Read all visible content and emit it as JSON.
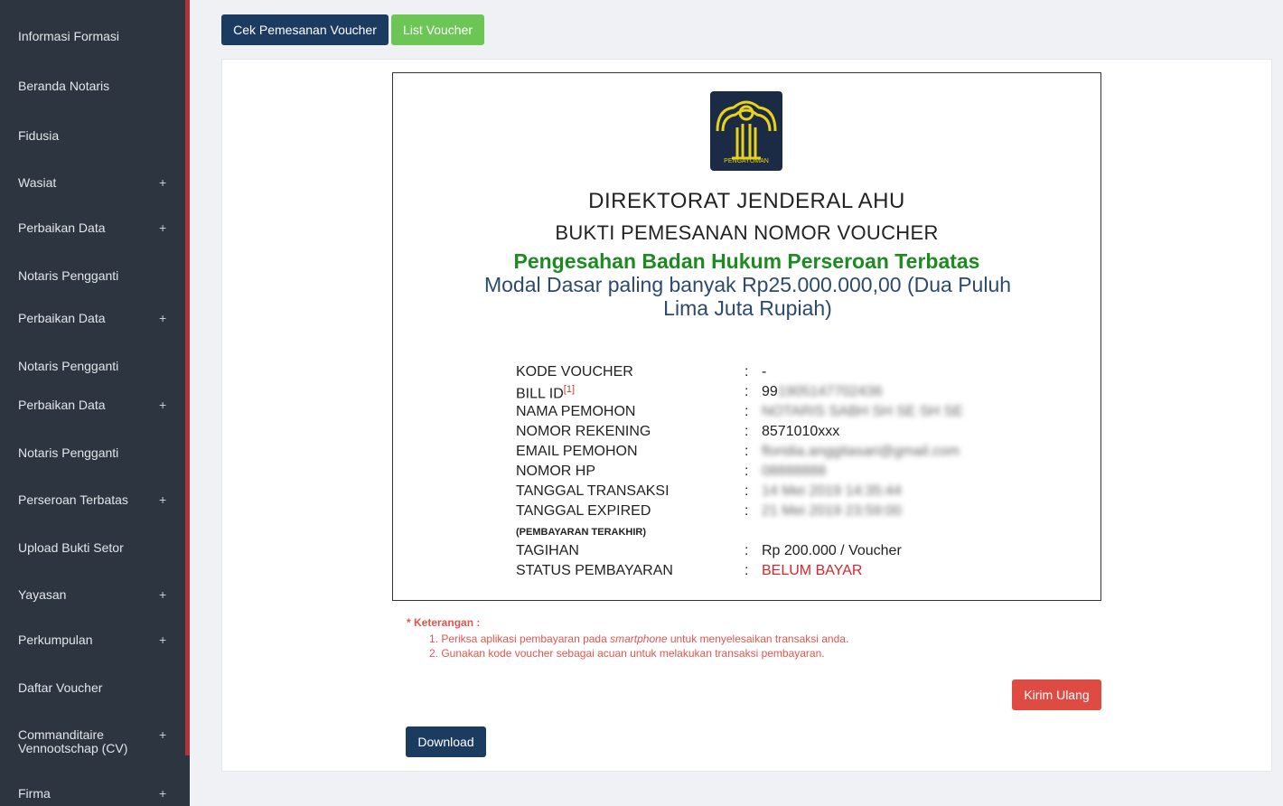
{
  "sidebar": {
    "items": [
      {
        "label": "Informasi Formasi",
        "expandable": false
      },
      {
        "label": "Beranda Notaris",
        "expandable": false
      },
      {
        "label": "Fidusia",
        "expandable": false
      },
      {
        "label": "Wasiat",
        "expandable": true
      },
      {
        "label": "Perbaikan Data",
        "expandable": true
      },
      {
        "label": "Notaris Pengganti",
        "expandable": false
      },
      {
        "label": "Perbaikan Data",
        "expandable": true
      },
      {
        "label": "Notaris Pengganti",
        "expandable": false
      },
      {
        "label": "Perbaikan Data",
        "expandable": true
      },
      {
        "label": "Notaris Pengganti",
        "expandable": false
      },
      {
        "label": "Perseroan Terbatas",
        "expandable": true
      },
      {
        "label": "Upload Bukti Setor",
        "expandable": false
      },
      {
        "label": "Yayasan",
        "expandable": true
      },
      {
        "label": "Perkumpulan",
        "expandable": true
      },
      {
        "label": "Daftar Voucher",
        "expandable": false
      },
      {
        "label": "Commanditaire Vennootschap (CV)",
        "expandable": true
      },
      {
        "label": "Firma",
        "expandable": true
      }
    ],
    "plus_symbol": "+"
  },
  "toolbar": {
    "cek_label": "Cek Pemesanan Voucher",
    "list_label": "List Voucher"
  },
  "receipt": {
    "logo_text": "PENGAYOMAN",
    "title": "DIREKTORAT JENDERAL AHU",
    "subtitle": "BUKTI PEMESANAN NOMOR VOUCHER",
    "service": "Pengesahan Badan Hukum Perseroan Terbatas",
    "capital": "Modal Dasar paling banyak Rp25.000.000,00 (Dua Puluh Lima Juta Rupiah)",
    "separator": ":",
    "fields": {
      "kode_voucher": {
        "label": "KODE VOUCHER",
        "value": "-"
      },
      "bill_id": {
        "label": "BILL ID",
        "footnote": "[1]",
        "value_prefix": "99",
        "value_hidden": "1905147702436"
      },
      "nama_pemohon": {
        "label": "NAMA PEMOHON",
        "value_hidden": "NOTARIS SABH SH SE SH SE"
      },
      "nomor_rekening": {
        "label": "NOMOR REKENING",
        "value": "8571010xxx"
      },
      "email_pemohon": {
        "label": "EMAIL PEMOHON",
        "value_hidden": "floridia.anggitasari@gmail.com"
      },
      "nomor_hp": {
        "label": "NOMOR HP",
        "value_hidden": "08888888"
      },
      "tanggal_transaksi": {
        "label": "TANGGAL TRANSAKSI",
        "value_hidden": "14 Mei 2019 14:35:44"
      },
      "tanggal_expired": {
        "label": "TANGGAL EXPIRED",
        "value_hidden": "21 Mei 2019 23:59:00",
        "note": "(PEMBAYARAN TERAKHIR)"
      },
      "tagihan": {
        "label": "TAGIHAN",
        "value": "Rp 200.000 / Voucher"
      },
      "status": {
        "label": "STATUS PEMBAYARAN",
        "value": "BELUM BAYAR"
      }
    }
  },
  "notes": {
    "heading": "* Keterangan :",
    "line1_a": "1. Periksa aplikasi pembayaran pada ",
    "line1_em": "smartphone",
    "line1_b": " untuk menyelesaikan transaksi anda.",
    "line2": "2. Gunakan kode voucher sebagai acuan untuk melakukan transaksi pembayaran."
  },
  "actions": {
    "resend_label": "Kirim Ulang",
    "download_label": "Download"
  },
  "colors": {
    "sidebar_bg": "#2c3540",
    "navy": "#1b3c60",
    "green": "#6cc655",
    "red": "#de4b43",
    "service_green": "#1e8a22",
    "status_red": "#d9262c"
  }
}
